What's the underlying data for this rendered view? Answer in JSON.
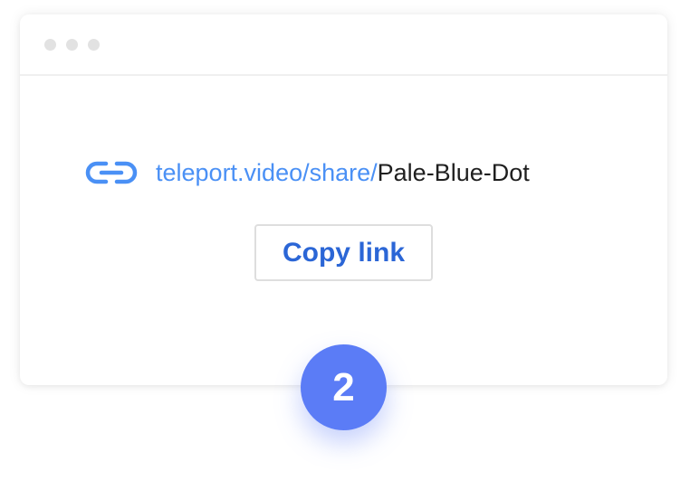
{
  "window": {
    "controls": [
      "dot",
      "dot",
      "dot"
    ]
  },
  "share": {
    "url_prefix": "teleport.video/share/",
    "url_slug": "Pale-Blue-Dot",
    "icon": "link-icon"
  },
  "actions": {
    "copy_label": "Copy link"
  },
  "step": {
    "number": "2"
  },
  "colors": {
    "link_blue": "#4a90f5",
    "button_text": "#2b66d6",
    "badge_bg": "#5b7cf6",
    "window_dots": "#e2e2e2"
  }
}
